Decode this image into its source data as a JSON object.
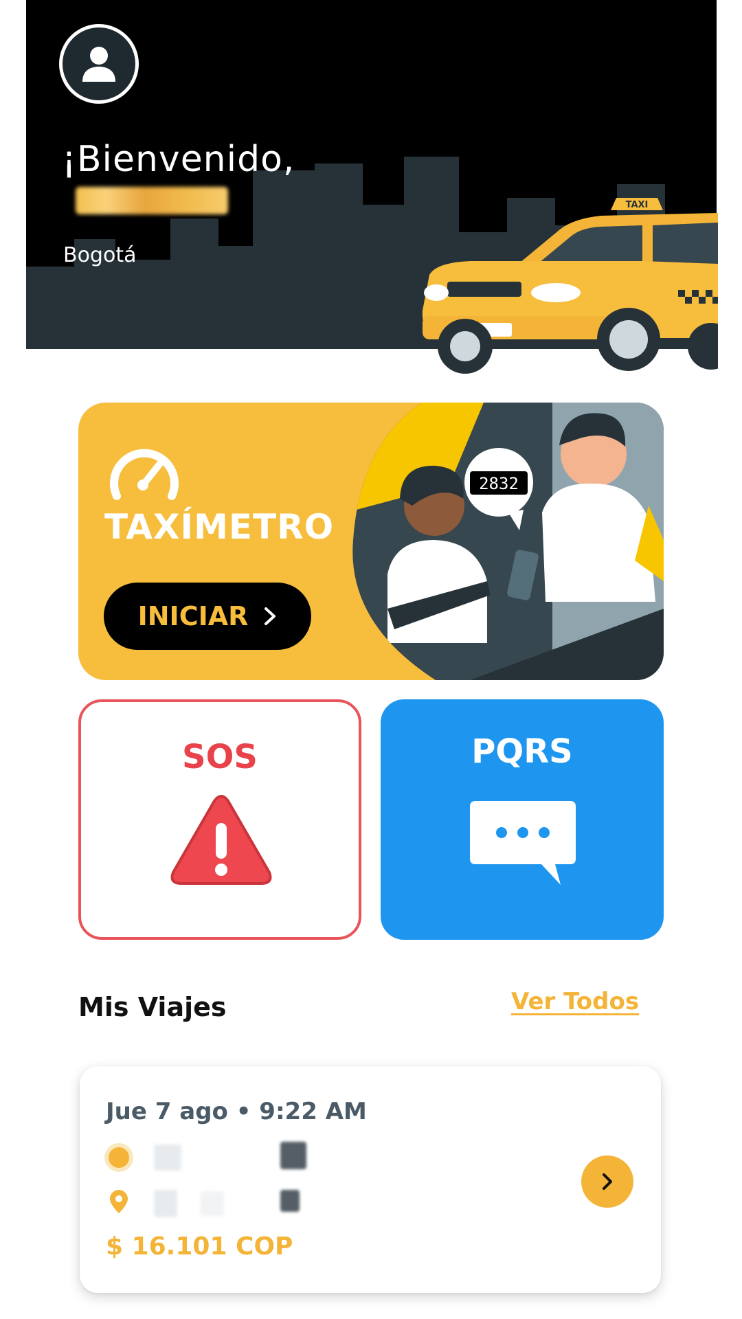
{
  "header": {
    "welcome": "¡Bienvenido,",
    "city": "Bogotá",
    "icons": {
      "avatar": "user-icon",
      "taxi_sign": "TAXI"
    }
  },
  "taximetro": {
    "title": "TAXÍMETRO",
    "button_label": "INICIAR",
    "meter_reading": "2832",
    "icons": {
      "gauge": "speedometer-icon",
      "button": "chevron-right-icon"
    }
  },
  "sos": {
    "label": "SOS",
    "icon": "warning-icon"
  },
  "pqrs": {
    "label": "PQRS",
    "icon": "chat-bubble-icon"
  },
  "trips": {
    "section_title": "Mis Viajes",
    "see_all_label": "Ver Todos",
    "items": [
      {
        "date": "Jue 7 ago • 9:22 AM",
        "price": "$ 16.101 COP"
      }
    ]
  },
  "colors": {
    "accent": "#f3b437",
    "card_yellow": "#f7bd3d",
    "sos_red": "#e8434b",
    "pqrs_blue": "#1e96f0",
    "header_bg": "#000000"
  }
}
